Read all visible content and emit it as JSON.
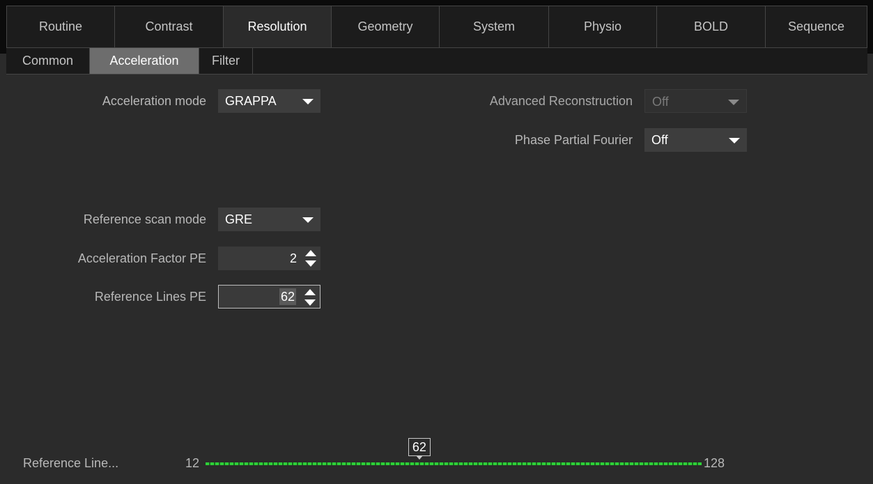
{
  "tabs": [
    "Routine",
    "Contrast",
    "Resolution",
    "Geometry",
    "System",
    "Physio",
    "BOLD",
    "Sequence"
  ],
  "active_tab": "Resolution",
  "subtabs": [
    "Common",
    "Acceleration",
    "Filter"
  ],
  "active_subtab": "Acceleration",
  "fields": {
    "acceleration_mode": {
      "label": "Acceleration mode",
      "value": "GRAPPA"
    },
    "advanced_reconstruction": {
      "label": "Advanced Reconstruction",
      "value": "Off"
    },
    "phase_partial_fourier": {
      "label": "Phase Partial Fourier",
      "value": "Off"
    },
    "reference_scan_mode": {
      "label": "Reference scan mode",
      "value": "GRE"
    },
    "acceleration_factor_pe": {
      "label": "Acceleration Factor PE",
      "value": "2"
    },
    "reference_lines_pe": {
      "label": "Reference Lines PE",
      "value": "62"
    }
  },
  "slider": {
    "label": "Reference Line...",
    "min": "12",
    "max": "128",
    "value": "62",
    "value_num": 62,
    "min_num": 12,
    "max_num": 128
  },
  "colors": {
    "accent_green": "#2ecf38",
    "background": "#2b2b2b"
  }
}
